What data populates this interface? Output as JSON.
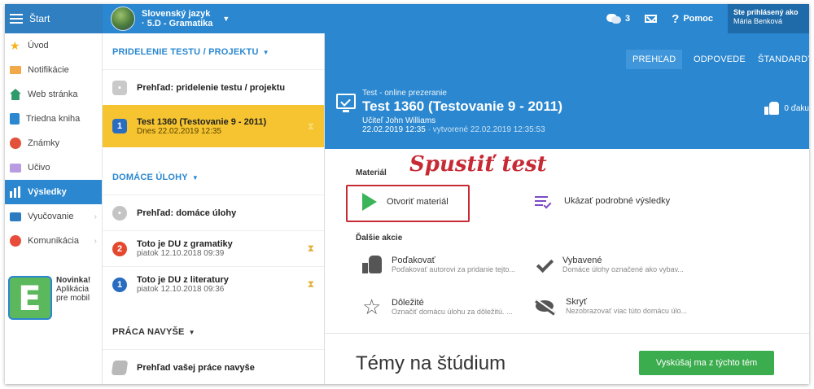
{
  "topbar": {
    "start_label": "Štart",
    "subject_line1": "Slovenský jazyk",
    "subject_line2": "· 5.D - Gramatika",
    "messages_count": "3",
    "help_label": "Pomoc",
    "user_line1": "Ste prihlásený ako",
    "user_line2": "Mária Benková"
  },
  "sidebar": {
    "items": [
      {
        "label": "Úvod",
        "icon": "star-icon"
      },
      {
        "label": "Notifikácie",
        "icon": "envelope-icon"
      },
      {
        "label": "Web stránka",
        "icon": "home-icon"
      },
      {
        "label": "Triedna kniha",
        "icon": "book-icon"
      },
      {
        "label": "Známky",
        "icon": "grades-icon"
      },
      {
        "label": "Učivo",
        "icon": "learning-icon"
      },
      {
        "label": "Výsledky",
        "icon": "bar-chart-icon",
        "active": true
      },
      {
        "label": "Vyučovanie",
        "icon": "teaching-icon"
      },
      {
        "label": "Komunikácia",
        "icon": "chat-icon"
      }
    ],
    "promo": {
      "title": "Novinka!",
      "line1": "Aplikácia",
      "line2": "pre mobil"
    }
  },
  "middle": {
    "section1": "PRIDELENIE TESTU / PROJEKTU",
    "s1_overview": "Prehľad: pridelenie testu / projektu",
    "s1_item": {
      "num": "1",
      "title": "Test 1360 (Testovanie 9 - 2011)",
      "date": "Dnes 22.02.2019 12:35"
    },
    "section2": "DOMÁCE ÚLOHY",
    "s2_overview": "Prehľad: domáce úlohy",
    "s2_items": [
      {
        "num": "2",
        "title": "Toto je DU z gramatiky",
        "date": "piatok 12.10.2018 09:39",
        "color": "#e4482f"
      },
      {
        "num": "1",
        "title": "Toto je DU z literatury",
        "date": "piatok 12.10.2018 09:36",
        "color": "#2a6dc0"
      }
    ],
    "section3": "PRÁCA NAVYŠE",
    "s3_overview": "Prehľad vašej práce navyše"
  },
  "main": {
    "tabs": [
      "PREHĽAD",
      "ODPOVEDE",
      "ŠTANDARDY"
    ],
    "header": {
      "kind": "Test - online prezeranie",
      "title": "Test 1360 (Testovanie 9 - 2011)",
      "teacher": "Učiteľ John Williams",
      "date": "22.02.2019 12:35",
      "created": "· vytvorené 22.02.2019 12:35:53",
      "likes": "0 ďaku"
    },
    "material_label": "Materiál",
    "annotation": "Spustiť test",
    "open_material": "Otvoriť materiál",
    "show_results": "Ukázať podrobné výsledky",
    "more_actions": "Ďalšie akcie",
    "actions": [
      {
        "title": "Poďakovať",
        "sub": "Poďakovať autorovi za pridanie tejto..."
      },
      {
        "title": "Vybavené",
        "sub": "Domáce úlohy označené ako vybav..."
      },
      {
        "title": "Dôležité",
        "sub": "Označiť domácu úlohu za dôležitú. ..."
      },
      {
        "title": "Skryť",
        "sub": "Nezobrazovať viac túto domácu úlo..."
      }
    ],
    "topics_heading": "Témy na štúdium",
    "topics_button": "Vyskúšaj ma z týchto tém"
  },
  "colors": {
    "primary": "#2a87d0",
    "selected": "#f5c430",
    "green": "#3cad4e",
    "annotation": "#c62b35"
  }
}
